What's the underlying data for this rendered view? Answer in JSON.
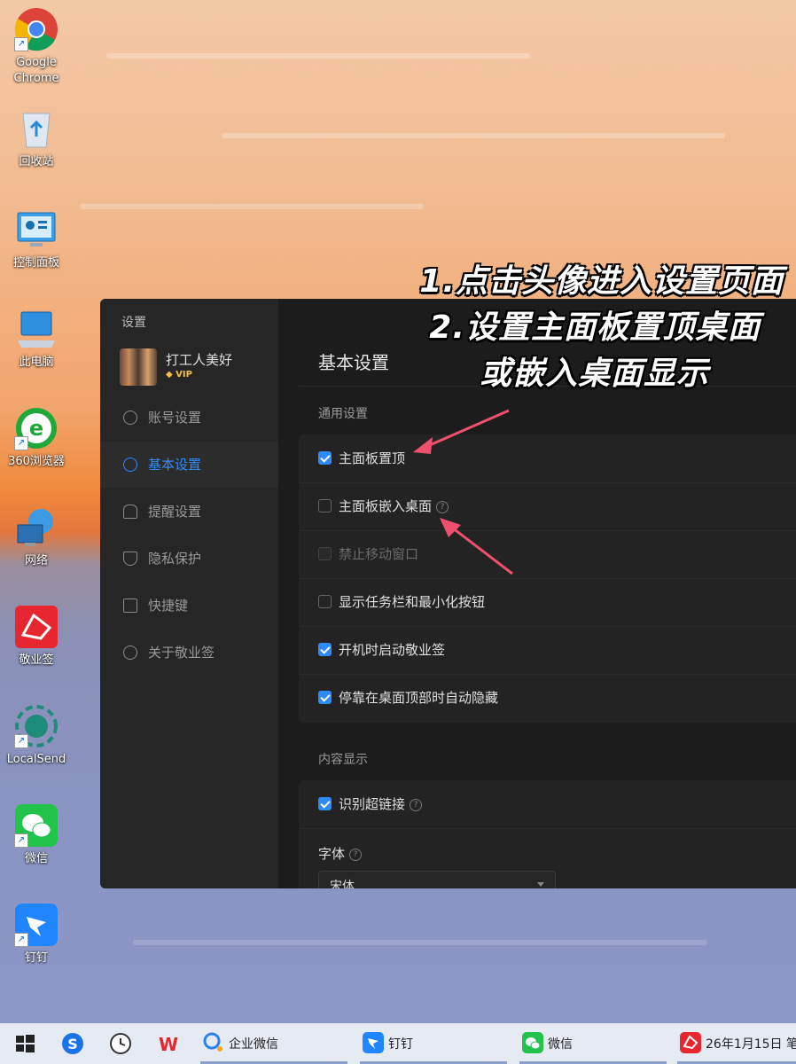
{
  "desktop": {
    "icons": [
      {
        "label": "Google Chrome",
        "icon": "chrome-icon"
      },
      {
        "label": "回收站",
        "icon": "recycle-bin-icon"
      },
      {
        "label": "控制面板",
        "icon": "control-panel-icon"
      },
      {
        "label": "此电脑",
        "icon": "computer-icon"
      },
      {
        "label": "360浏览器",
        "icon": "360-browser-icon"
      },
      {
        "label": "网络",
        "icon": "network-icon"
      },
      {
        "label": "敬业签",
        "icon": "jingyeqian-icon"
      },
      {
        "label": "LocalSend",
        "icon": "localsend-icon"
      },
      {
        "label": "微信",
        "icon": "wechat-icon"
      },
      {
        "label": "钉钉",
        "icon": "dingtalk-icon"
      }
    ]
  },
  "annotation": {
    "line1": "1.点击头像进入设置页面",
    "line2": "2.设置主面板置顶桌面",
    "line3": "或嵌入桌面显示"
  },
  "settings": {
    "title": "设置",
    "profile": {
      "name": "打工人美好",
      "badge": "VIP"
    },
    "nav": [
      {
        "label": "账号设置",
        "icon": "user-icon"
      },
      {
        "label": "基本设置",
        "icon": "settings-icon",
        "active": true
      },
      {
        "label": "提醒设置",
        "icon": "bell-icon"
      },
      {
        "label": "隐私保护",
        "icon": "shield-icon"
      },
      {
        "label": "快捷键",
        "icon": "keyboard-icon"
      },
      {
        "label": "关于敬业签",
        "icon": "info-icon"
      }
    ],
    "main_title": "基本设置",
    "general": {
      "label": "通用设置",
      "options": [
        {
          "label": "主面板置顶",
          "checked": true
        },
        {
          "label": "主面板嵌入桌面",
          "checked": false,
          "help": true
        },
        {
          "label": "禁止移动窗口",
          "checked": false,
          "disabled": true
        },
        {
          "label": "显示任务栏和最小化按钮",
          "checked": false
        },
        {
          "label": "开机时启动敬业签",
          "checked": true
        },
        {
          "label": "停靠在桌面顶部时自动隐藏",
          "checked": true
        }
      ]
    },
    "content": {
      "label": "内容显示",
      "options": [
        {
          "label": "识别超链接",
          "checked": true,
          "help": true
        }
      ],
      "font_label": "字体",
      "font_value": "宋体"
    }
  },
  "taskbar": {
    "apps": [
      {
        "label": "企业微信"
      },
      {
        "label": "钉钉"
      },
      {
        "label": "微信"
      }
    ],
    "status_text": "26年1月15日 笔"
  },
  "colors": {
    "accent": "#2e8bff",
    "arrow": "#f0506e"
  }
}
